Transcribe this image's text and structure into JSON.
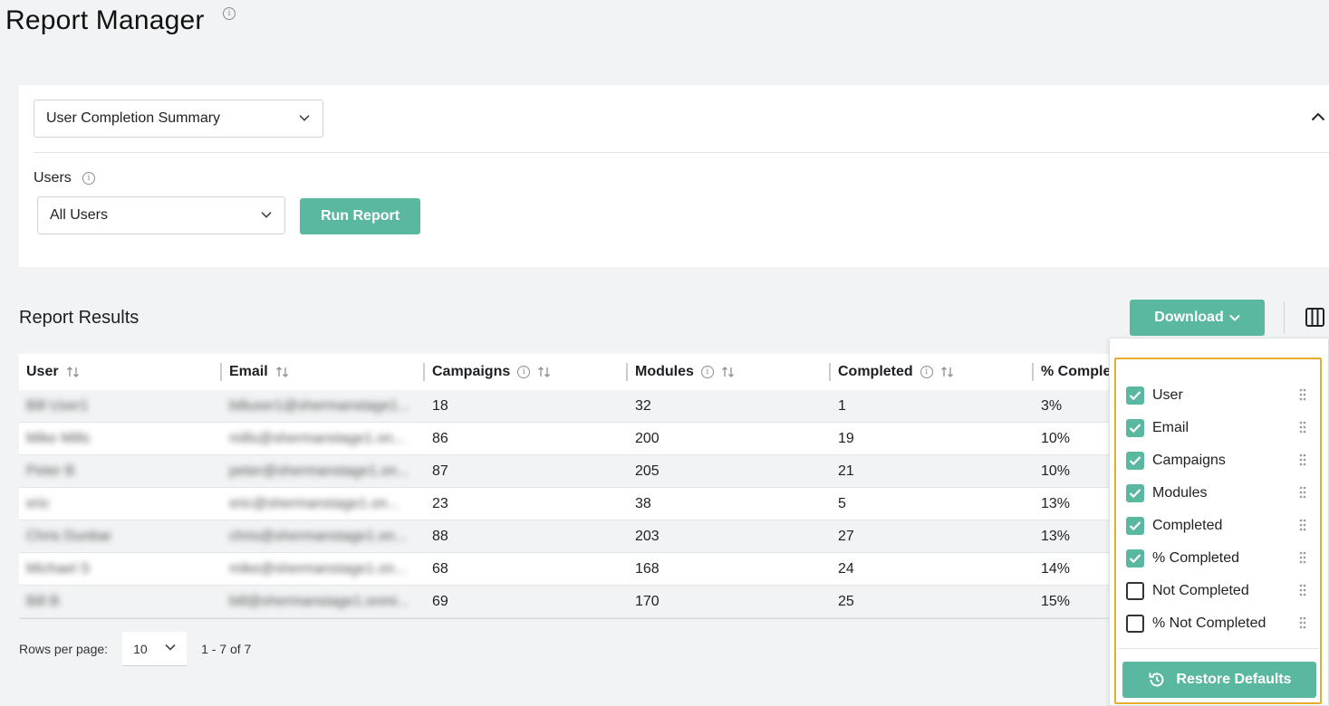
{
  "page": {
    "title": "Report Manager",
    "title_info_icon": "info-icon"
  },
  "filters": {
    "report_type": "User Completion Summary",
    "users_label": "Users",
    "users_value": "All Users",
    "run_label": "Run Report"
  },
  "results": {
    "title": "Report Results",
    "download_label": "Download",
    "columns_icon": "columns-icon"
  },
  "table": {
    "headers": [
      "User",
      "Email",
      "Campaigns",
      "Modules",
      "Completed",
      "% Comple"
    ],
    "rows": [
      {
        "user": "Bill User1",
        "email": "billuser1@shermanstage1...",
        "campaigns": "18",
        "modules": "32",
        "completed": "1",
        "pct": "3%"
      },
      {
        "user": "Mike Mills",
        "email": "mills@shermanstage1.on...",
        "campaigns": "86",
        "modules": "200",
        "completed": "19",
        "pct": "10%"
      },
      {
        "user": "Peter B",
        "email": "peter@shermanstage1.on...",
        "campaigns": "87",
        "modules": "205",
        "completed": "21",
        "pct": "10%"
      },
      {
        "user": "eric",
        "email": "eric@shermanstage1.on...",
        "campaigns": "23",
        "modules": "38",
        "completed": "5",
        "pct": "13%"
      },
      {
        "user": "Chris Dunbar",
        "email": "chris@shermanstage1.on...",
        "campaigns": "88",
        "modules": "203",
        "completed": "27",
        "pct": "13%"
      },
      {
        "user": "Michael S",
        "email": "mike@shermanstage1.on...",
        "campaigns": "68",
        "modules": "168",
        "completed": "24",
        "pct": "14%"
      },
      {
        "user": "Bill B",
        "email": "bill@shermanstage1.onmi...",
        "campaigns": "69",
        "modules": "170",
        "completed": "25",
        "pct": "15%"
      }
    ]
  },
  "pagination": {
    "rows_per_page_label": "Rows per page:",
    "rows_per_page_value": "10",
    "range": "1 - 7 of 7"
  },
  "column_panel": {
    "items": [
      {
        "label": "User",
        "checked": true
      },
      {
        "label": "Email",
        "checked": true
      },
      {
        "label": "Campaigns",
        "checked": true
      },
      {
        "label": "Modules",
        "checked": true
      },
      {
        "label": "Completed",
        "checked": true
      },
      {
        "label": "% Completed",
        "checked": true
      },
      {
        "label": "Not Completed",
        "checked": false
      },
      {
        "label": "% Not Completed",
        "checked": false
      }
    ],
    "restore_label": "Restore Defaults"
  },
  "colors": {
    "accent": "#5bb8a0",
    "highlight": "#e8ad2c"
  }
}
